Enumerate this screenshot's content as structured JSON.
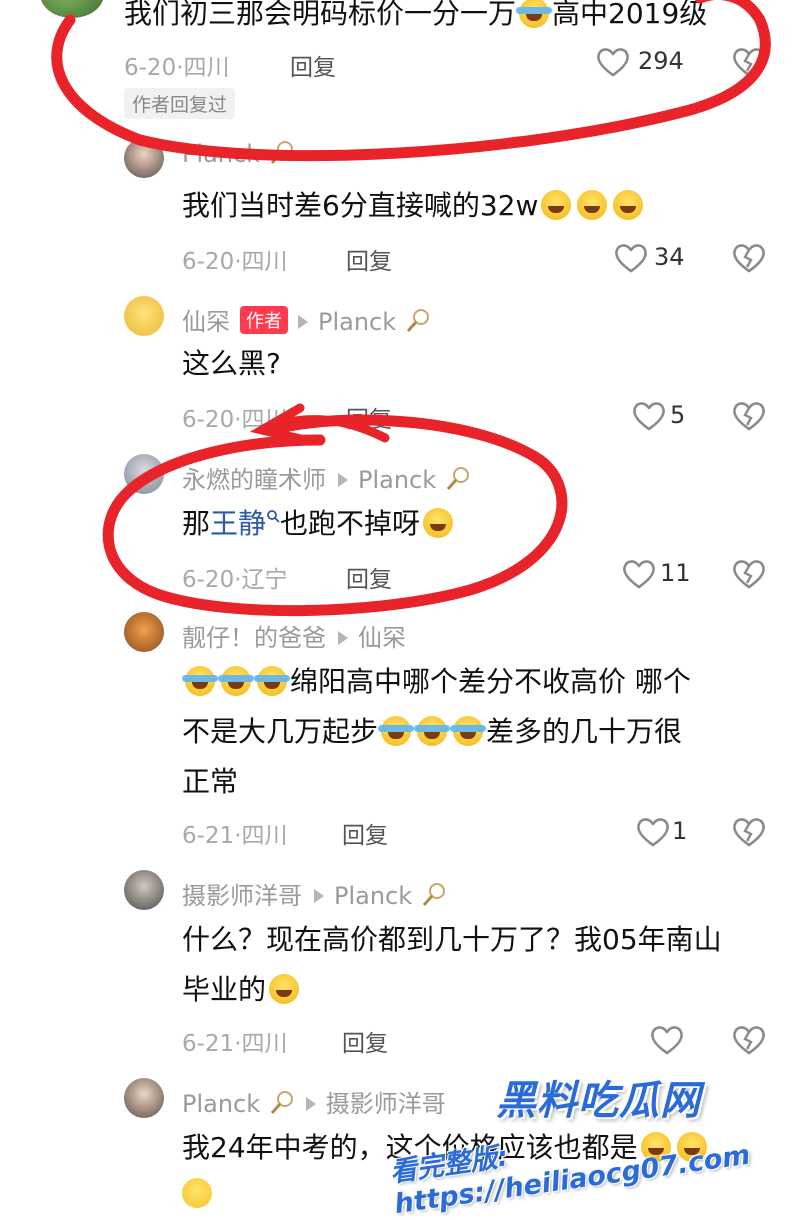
{
  "comments": [
    {
      "text_before": "我们初三那会明码标价一分一万",
      "text_after": "高中2019级",
      "meta": "6-20·四川",
      "reply": "回复",
      "likes": "294",
      "tag": "作者回复过"
    },
    {
      "user": "Planck",
      "text": "我们当时差6分直接喊的32w",
      "meta": "6-20·四川",
      "reply": "回复",
      "likes": "34"
    },
    {
      "user": "仙罙",
      "author_badge": "作者",
      "reply_to": "Planck",
      "text": "这么黑?",
      "meta": "6-20·四川",
      "reply": "回复",
      "likes": "5"
    },
    {
      "user": "永燃的瞳术师",
      "reply_to": "Planck",
      "text_before": "那",
      "link": "王静",
      "text_after": "也跑不掉呀",
      "meta": "6-20·辽宁",
      "reply": "回复",
      "likes": "11"
    },
    {
      "user": "靓仔！的爸爸",
      "reply_to": "仙罙",
      "line1": "绵阳高中哪个差分不收高价  哪个",
      "line2_before": "不是大几万起步",
      "line2_after": "差多的几十万很",
      "line3": "正常",
      "meta": "6-21·四川",
      "reply": "回复",
      "likes": "1"
    },
    {
      "user": "摄影师洋哥",
      "reply_to": "Planck",
      "line1": "什么？现在高价都到几十万了？我05年南山",
      "line2": "毕业的",
      "meta": "6-21·四川",
      "reply": "回复",
      "likes": ""
    },
    {
      "user": "Planck",
      "reply_to": "摄影师洋哥",
      "text": "我24年中考的，这个价格应该也都是"
    }
  ],
  "watermark": {
    "title": "黑料吃瓜网",
    "subtitle": "看完整版: https://heiliaocg07.com"
  },
  "colors": {
    "annotation": "#e8232a",
    "author_badge": "#ff3b4f",
    "watermark": "#2a6bd8"
  }
}
